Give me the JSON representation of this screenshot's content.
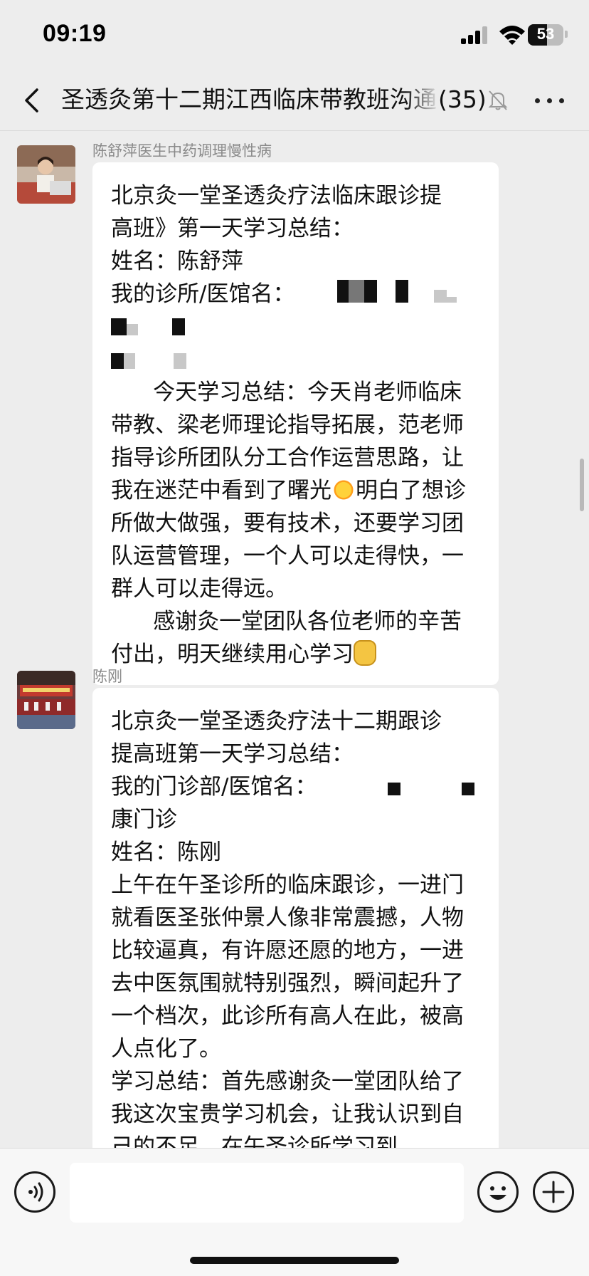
{
  "status_bar": {
    "time": "09:19",
    "battery_level": "53",
    "icons": [
      "signal-icon",
      "wifi-icon",
      "battery-icon"
    ]
  },
  "nav": {
    "back_icon": "chevron-left-icon",
    "title": "圣透灸第十二期江西临床带教班沟通",
    "member_count": "(35)",
    "mute_icon": "bell-slash-icon",
    "more_icon": "ellipsis-icon"
  },
  "messages": [
    {
      "sender": "陈舒萍医生中药调理慢性病",
      "lines": [
        "北京灸一堂圣透灸疗法临床跟诊提",
        "高班》第一天学习总结：",
        "姓名：陈舒萍",
        "我的诊所/医馆名："
      ],
      "body_1": "      今天学习总结：今天肖老师临床带教、梁老师理论指导拓展，范老师指导诊所团队分工合作运营思路，让我在迷茫中看到了曙光",
      "body_2": "明白了想诊所做大做强，要有技术，还要学习团队运营管理，一个人可以走得快，一群人可以走得远。",
      "body_3": "      感谢灸一堂团队各位老师的辛苦付出，明天继续用心学习"
    },
    {
      "sender": "陈刚",
      "lines": [
        "北京灸一堂圣透灸疗法十二期跟诊",
        "提高班第一天学习总结：",
        "我的门诊部/医馆名：",
        "康门诊",
        "姓名：陈刚"
      ],
      "body_1": "上午在午圣诊所的临床跟诊，一进门就看医圣张仲景人像非常震撼，人物比较逼真，有许愿还愿的地方，一进去中医氛围就特别强烈，瞬间起升了一个档次，此诊所有高人在此，被高人点化了。",
      "body_2": "学习总结：首先感谢灸一堂团队给了我这次宝贵学习机会，让我认识到自己的不足，在午圣诊所学习到"
    }
  ],
  "input_bar": {
    "voice_icon": "voice-icon",
    "emoji_icon": "smiley-icon",
    "plus_icon": "plus-icon",
    "input_value": ""
  }
}
